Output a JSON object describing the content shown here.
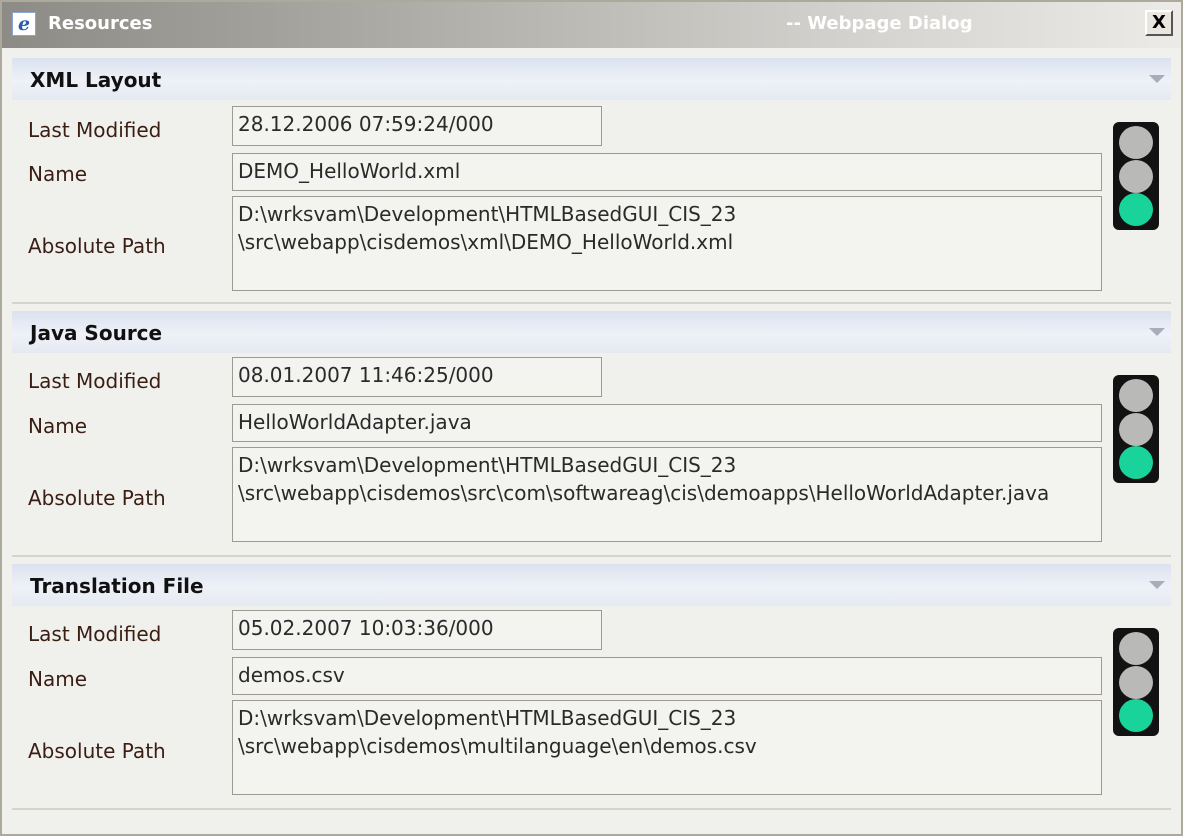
{
  "window": {
    "title_left": "Resources",
    "title_right": "-- Webpage Dialog",
    "close_label": "X",
    "icon": "ie-icon"
  },
  "labels": {
    "last_modified": "Last Modified",
    "name": "Name",
    "absolute_path": "Absolute Path"
  },
  "sections": [
    {
      "title": "XML Layout",
      "last_modified": "28.12.2006 07:59:24/000",
      "name": "DEMO_HelloWorld.xml",
      "absolute_path": "D:\\wrksvam\\Development\\HTMLBasedGUI_CIS_23 \\src\\webapp\\cisdemos\\xml\\DEMO_HelloWorld.xml",
      "status_light": "green"
    },
    {
      "title": "Java Source",
      "last_modified": "08.01.2007 11:46:25/000",
      "name": "HelloWorldAdapter.java",
      "absolute_path": "D:\\wrksvam\\Development\\HTMLBasedGUI_CIS_23 \\src\\webapp\\cisdemos\\src\\com\\softwareag\\cis\\demoapps\\HelloWorldAdapter.java",
      "status_light": "green"
    },
    {
      "title": "Translation File",
      "last_modified": "05.02.2007 10:03:36/000",
      "name": "demos.csv",
      "absolute_path": "D:\\wrksvam\\Development\\HTMLBasedGUI_CIS_23 \\src\\webapp\\cisdemos\\multilanguage\\en\\demos.csv",
      "status_light": "green"
    }
  ],
  "colors": {
    "light_on": "#18d49a",
    "light_off": "#b9b9b7"
  }
}
